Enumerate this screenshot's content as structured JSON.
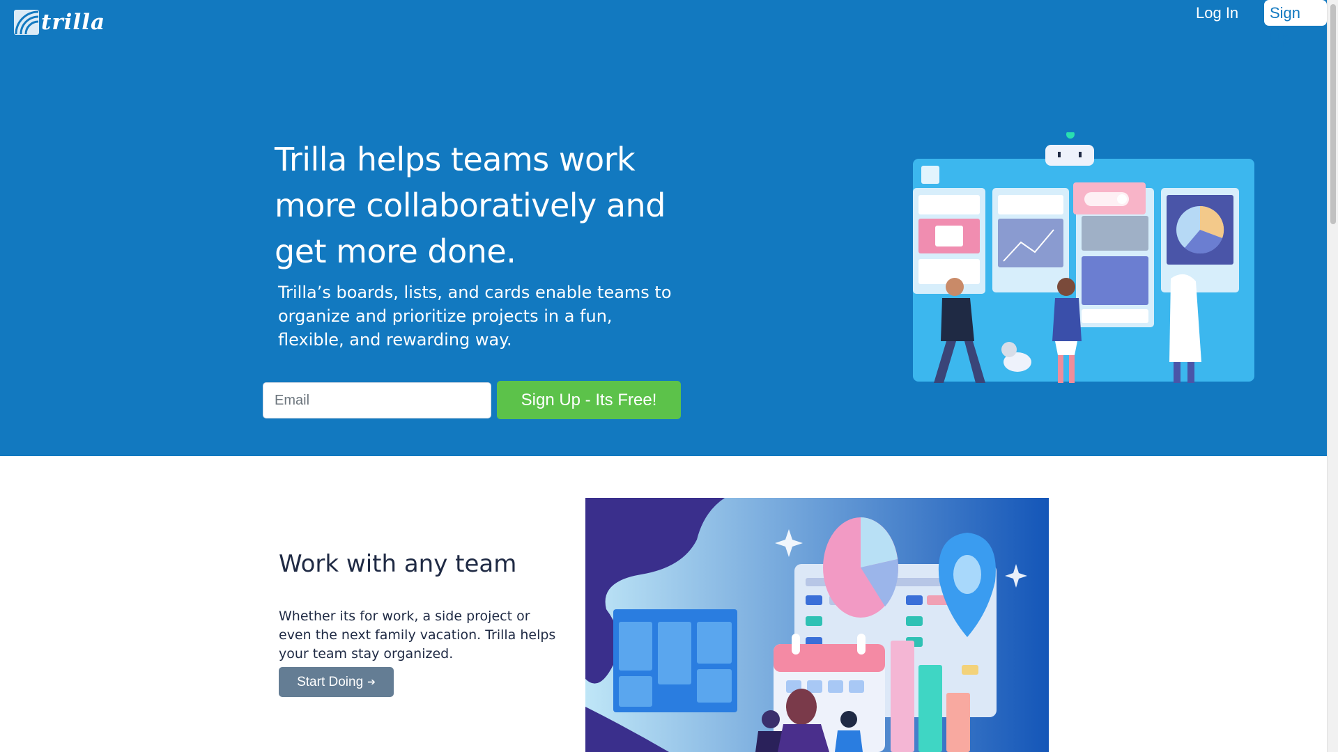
{
  "brand": {
    "logo_text": "trilla",
    "logo_icon": "trilla-logo-icon"
  },
  "nav": {
    "login_label": "Log In",
    "signup_label": "Sign Up"
  },
  "hero": {
    "title": "Trilla helps teams work more collaboratively and get more done.",
    "subtitle": "Trilla’s boards, lists, and cards enable teams to organize and prioritize projects in a fun, flexible, and rewarding way.",
    "email_placeholder": "Email",
    "email_value": "",
    "cta_label": "Sign Up - Its Free!",
    "illustration": "team-board-illustration"
  },
  "feature": {
    "title": "Work with any team",
    "text": "Whether its for work, a side project or even the next family vacation. Trilla helps your team stay organized.",
    "button_label": "Start Doing",
    "button_icon": "arrow-right-icon",
    "illustration": "team-dashboard-illustration"
  },
  "colors": {
    "hero_background": "#1279c0",
    "cta_green": "#5cc24a",
    "start_button": "#647d94",
    "heading_text": "#1f2a44"
  }
}
